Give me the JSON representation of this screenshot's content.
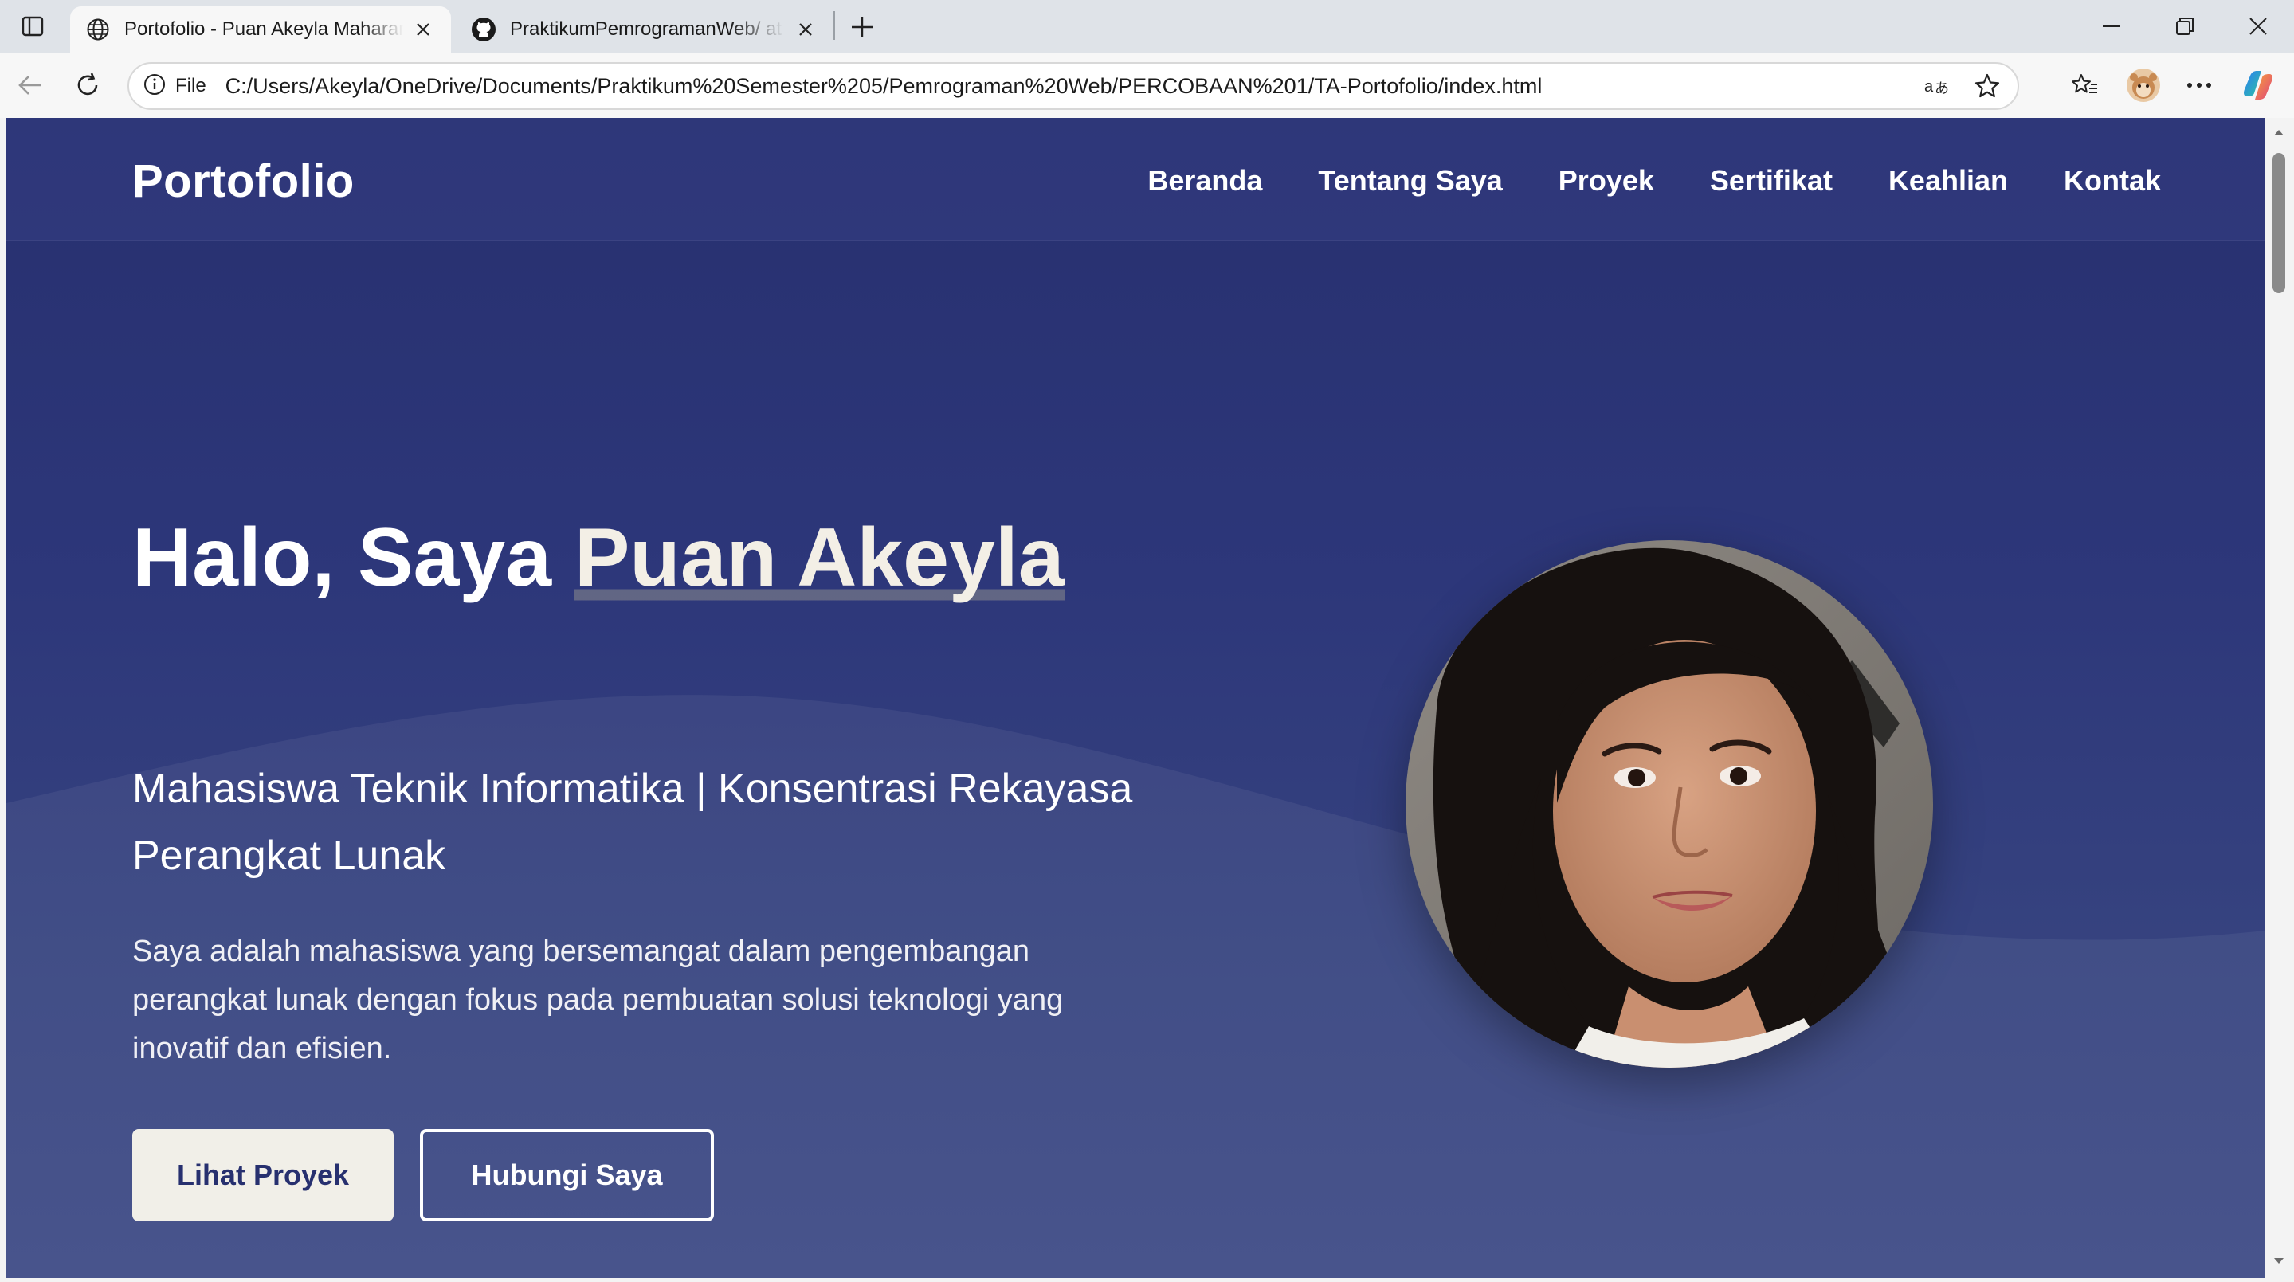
{
  "browser": {
    "tabs": [
      {
        "title": "Portofolio - Puan Akeyla Maharani",
        "favicon": "globe-icon",
        "active": true
      },
      {
        "title": "PraktikumPemrogramanWeb/ at main",
        "favicon": "github-icon",
        "active": false
      }
    ],
    "address": {
      "scheme_label": "File",
      "url": "C:/Users/Akeyla/OneDrive/Documents/Praktikum%20Semester%205/Pemrograman%20Web/PERCOBAAN%201/TA-Portofolio/index.html"
    }
  },
  "site": {
    "logo": "Portofolio",
    "nav": [
      "Beranda",
      "Tentang Saya",
      "Proyek",
      "Sertifikat",
      "Keahlian",
      "Kontak"
    ],
    "hero": {
      "greeting": "Halo, Saya ",
      "name": "Puan Akeyla",
      "subtitle": "Mahasiswa Teknik Informatika | Konsentrasi Rekayasa Perangkat Lunak",
      "description": "Saya adalah mahasiswa yang bersemangat dalam pengembangan perangkat lunak dengan fokus pada pembuatan solusi teknologi yang inovatif dan efisien.",
      "primary_button": "Lihat Proyek",
      "secondary_button": "Hubungi Saya"
    }
  },
  "colors": {
    "hero_bg_top": "#27306f",
    "hero_bg_bottom": "#3d4a85",
    "primary_button_bg": "#f1efe8",
    "primary_button_text": "#27306f"
  }
}
